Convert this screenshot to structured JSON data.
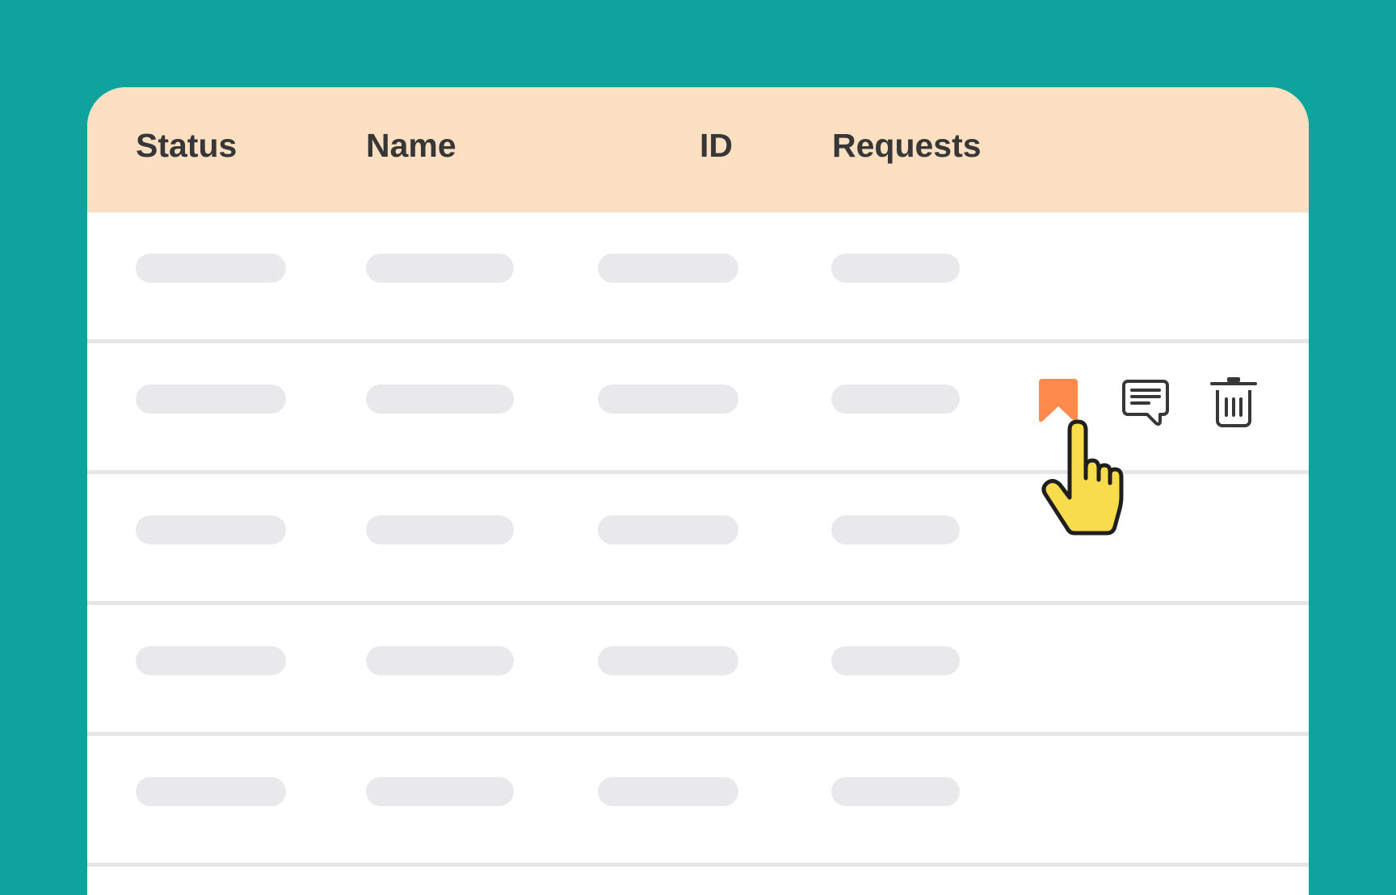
{
  "table": {
    "columns": [
      {
        "key": "status",
        "label": "Status"
      },
      {
        "key": "name",
        "label": "Name"
      },
      {
        "key": "id",
        "label": "ID"
      },
      {
        "key": "requests",
        "label": "Requests"
      }
    ],
    "row_count": 5,
    "hovered_row": 2
  },
  "row_actions": [
    {
      "icon": "bookmark-icon",
      "color": "#ff8a4c"
    },
    {
      "icon": "comment-icon",
      "color": "#373737"
    },
    {
      "icon": "trash-icon",
      "color": "#373737"
    }
  ],
  "cursor": {
    "icon": "hand-pointer-icon",
    "color": "#f8dc4b"
  },
  "colors": {
    "background": "#0fa39e",
    "header": "#fddfc2",
    "placeholder": "#e9e9eb",
    "text": "#373737"
  }
}
